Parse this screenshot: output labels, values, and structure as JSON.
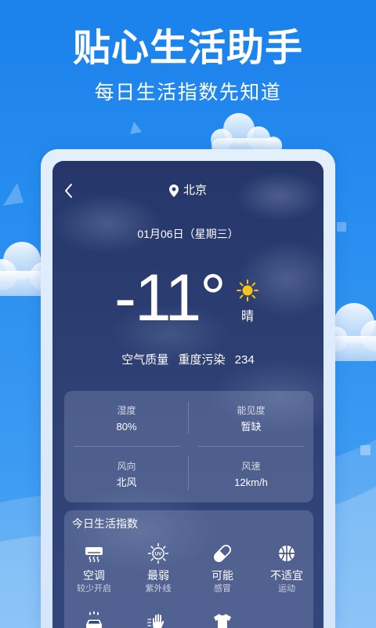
{
  "promo": {
    "title": "贴心生活助手",
    "subtitle": "每日生活指数先知道"
  },
  "header": {
    "back_icon": "chevron-left-icon",
    "location_icon": "map-pin-icon",
    "city": "北京"
  },
  "weather": {
    "date": "01月06日（星期三）",
    "temperature": "-11°",
    "condition": "晴",
    "condition_icon": "sun-icon",
    "air_quality": {
      "label": "空气质量",
      "level": "重度污染",
      "value": "234"
    }
  },
  "details": [
    {
      "label": "湿度",
      "value": "80%"
    },
    {
      "label": "能见度",
      "value": "暂缺"
    },
    {
      "label": "风向",
      "value": "北风"
    },
    {
      "label": "风速",
      "value": "12km/h"
    }
  ],
  "life_index": {
    "title": "今日生活指数",
    "items": [
      {
        "icon": "air-conditioner-icon",
        "primary": "空调",
        "secondary": "较少开启"
      },
      {
        "icon": "uv-icon",
        "icon_text": "UV",
        "primary": "最弱",
        "secondary": "紫外线"
      },
      {
        "icon": "pill-icon",
        "primary": "可能",
        "secondary": "感冒"
      },
      {
        "icon": "basketball-icon",
        "primary": "不适宜",
        "secondary": "运动"
      },
      {
        "icon": "car-wash-icon"
      },
      {
        "icon": "hand-icon"
      },
      {
        "icon": "tshirt-icon"
      }
    ]
  },
  "colors": {
    "background": "#1f86ee",
    "phone_frame": "#dbe9fb",
    "screen": "#2c3d70",
    "sun": "#f7c21a",
    "text": "#ffffff"
  }
}
